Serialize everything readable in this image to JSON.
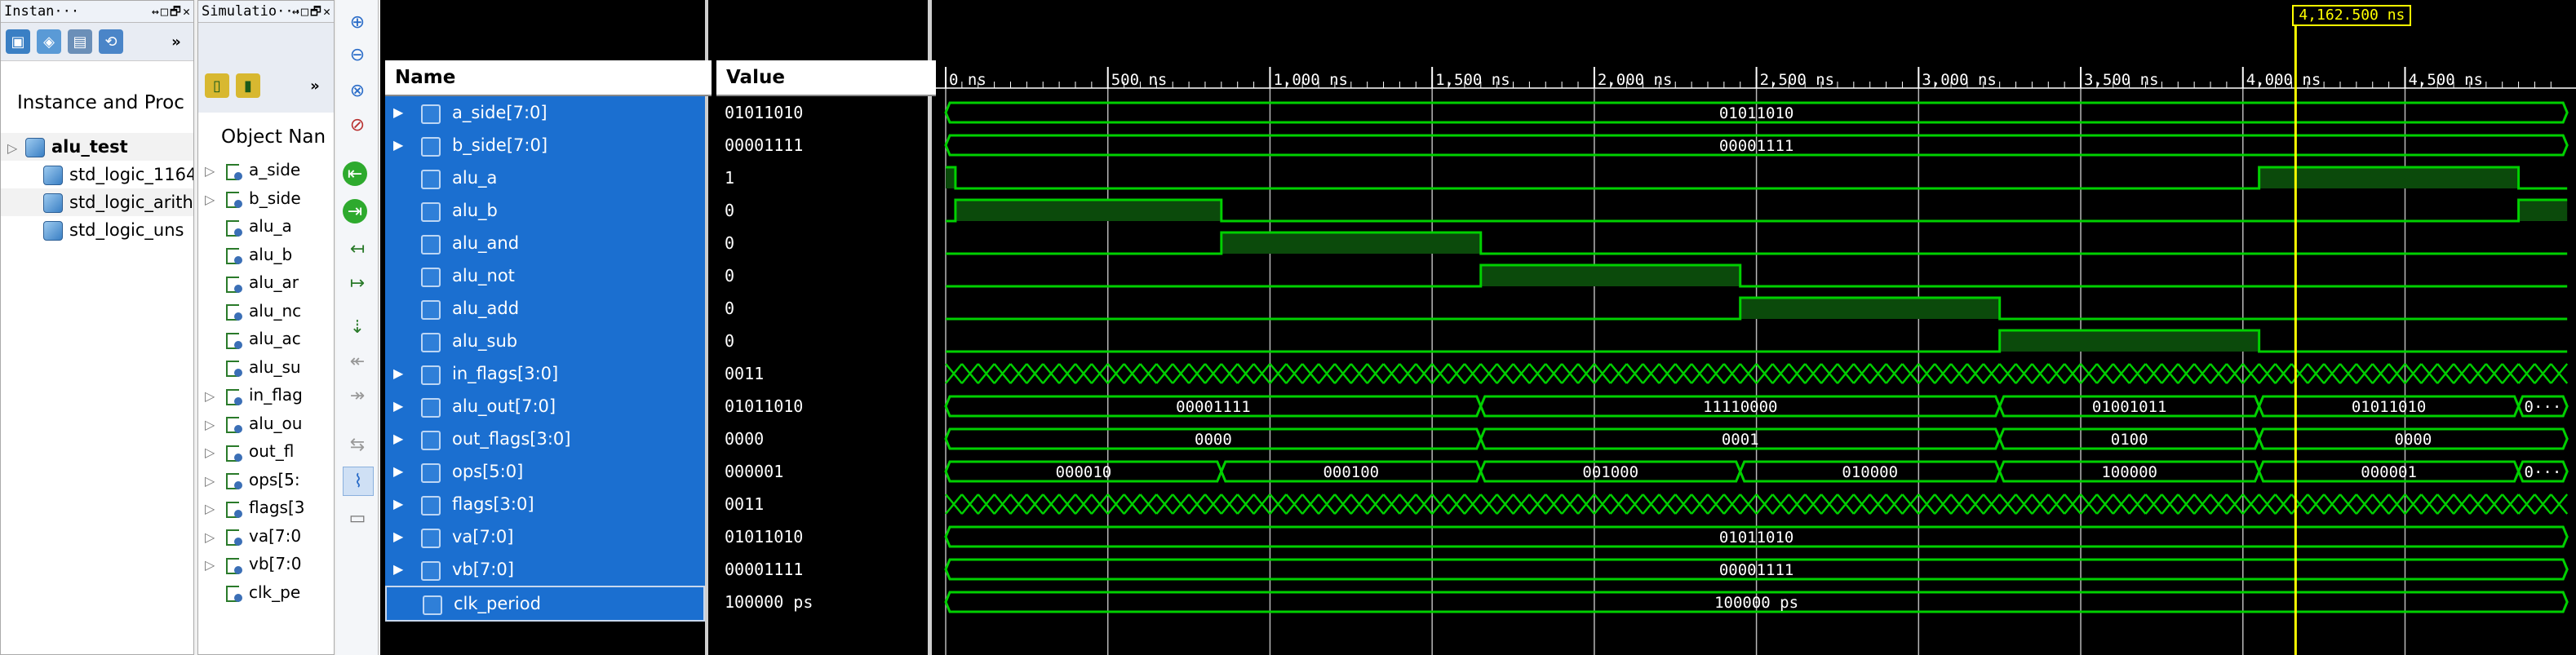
{
  "instance_panel": {
    "title": "Instan···",
    "title_controls": "↔□🗗✕",
    "column_header": "Instance and Proc",
    "items": [
      {
        "label": "alu_test",
        "bold": true
      },
      {
        "label": "std_logic_1164"
      },
      {
        "label": "std_logic_arith"
      },
      {
        "label": "std_logic_uns"
      }
    ]
  },
  "objects_panel": {
    "title": "Simulatio···",
    "title_controls": "↔□🗗✕",
    "column_header": "Object Nan",
    "items": [
      "a_side",
      "b_side",
      "alu_a",
      "alu_b",
      "alu_ar",
      "alu_nc",
      "alu_ac",
      "alu_su",
      "in_flag",
      "alu_ou",
      "out_fl",
      "ops[5:",
      "flags[3",
      "va[7:0",
      "vb[7:0",
      "clk_pe"
    ]
  },
  "wave_header": {
    "name_label": "Name",
    "value_label": "Value",
    "cursor_label": "4,162.500 ns"
  },
  "signals": [
    {
      "name": "a_side[7:0]",
      "value": "01011010",
      "expand": true
    },
    {
      "name": "b_side[7:0]",
      "value": "00001111",
      "expand": true
    },
    {
      "name": "alu_a",
      "value": "1",
      "expand": false
    },
    {
      "name": "alu_b",
      "value": "0",
      "expand": false
    },
    {
      "name": "alu_and",
      "value": "0",
      "expand": false
    },
    {
      "name": "alu_not",
      "value": "0",
      "expand": false
    },
    {
      "name": "alu_add",
      "value": "0",
      "expand": false
    },
    {
      "name": "alu_sub",
      "value": "0",
      "expand": false
    },
    {
      "name": "in_flags[3:0]",
      "value": "0011",
      "expand": true
    },
    {
      "name": "alu_out[7:0]",
      "value": "01011010",
      "expand": true
    },
    {
      "name": "out_flags[3:0]",
      "value": "0000",
      "expand": true
    },
    {
      "name": "ops[5:0]",
      "value": "000001",
      "expand": true
    },
    {
      "name": "flags[3:0]",
      "value": "0011",
      "expand": true
    },
    {
      "name": "va[7:0]",
      "value": "01011010",
      "expand": true
    },
    {
      "name": "vb[7:0]",
      "value": "00001111",
      "expand": true
    },
    {
      "name": "clk_period",
      "value": "100000 ps",
      "expand": false
    }
  ],
  "ruler": {
    "ticks": [
      "0 ns",
      "500 ns",
      "1,000 ns",
      "1,500 ns",
      "2,000 ns",
      "2,500 ns",
      "3,000 ns",
      "3,500 ns",
      "4,000 ns",
      "4,500 ns"
    ]
  },
  "waves": {
    "time_end_ns": 5000,
    "cursor_ns": 4162.5,
    "bits": [
      {
        "row": 2,
        "high": [
          [
            0,
            30
          ],
          [
            4050,
            4850
          ]
        ]
      },
      {
        "row": 3,
        "high": [
          [
            30,
            850
          ],
          [
            4850,
            5000
          ]
        ]
      },
      {
        "row": 4,
        "high": [
          [
            850,
            1650
          ]
        ]
      },
      {
        "row": 5,
        "high": [
          [
            1650,
            2450
          ]
        ]
      },
      {
        "row": 6,
        "high": [
          [
            2450,
            3250
          ]
        ]
      },
      {
        "row": 7,
        "high": [
          [
            3250,
            4050
          ]
        ]
      }
    ],
    "buses": [
      {
        "row": 0,
        "segments": [
          {
            "start": 0,
            "end": 5000,
            "label": "01011010"
          }
        ]
      },
      {
        "row": 1,
        "segments": [
          {
            "start": 0,
            "end": 5000,
            "label": "00001111"
          }
        ]
      },
      {
        "row": 9,
        "segments": [
          {
            "start": 0,
            "end": 1650,
            "label": "00001111"
          },
          {
            "start": 1650,
            "end": 3250,
            "label": "11110000"
          },
          {
            "start": 3250,
            "end": 4050,
            "label": "01001011"
          },
          {
            "start": 4050,
            "end": 4850,
            "label": "01011010"
          },
          {
            "start": 4850,
            "end": 5000,
            "label": "0···"
          }
        ]
      },
      {
        "row": 10,
        "segments": [
          {
            "start": 0,
            "end": 1650,
            "label": "0000"
          },
          {
            "start": 1650,
            "end": 3250,
            "label": "0001"
          },
          {
            "start": 3250,
            "end": 4050,
            "label": "0100"
          },
          {
            "start": 4050,
            "end": 5000,
            "label": "0000"
          }
        ]
      },
      {
        "row": 11,
        "segments": [
          {
            "start": 0,
            "end": 850,
            "label": "000010"
          },
          {
            "start": 850,
            "end": 1650,
            "label": "000100"
          },
          {
            "start": 1650,
            "end": 2450,
            "label": "001000"
          },
          {
            "start": 2450,
            "end": 3250,
            "label": "010000"
          },
          {
            "start": 3250,
            "end": 4050,
            "label": "100000"
          },
          {
            "start": 4050,
            "end": 4850,
            "label": "000001"
          },
          {
            "start": 4850,
            "end": 5000,
            "label": "0···"
          }
        ]
      },
      {
        "row": 13,
        "segments": [
          {
            "start": 0,
            "end": 5000,
            "label": "01011010"
          }
        ]
      },
      {
        "row": 14,
        "segments": [
          {
            "start": 0,
            "end": 5000,
            "label": "00001111"
          }
        ]
      },
      {
        "row": 15,
        "segments": [
          {
            "start": 0,
            "end": 5000,
            "label": "100000 ps"
          }
        ]
      }
    ],
    "dense_rows": [
      8,
      12
    ],
    "dense_period_ns": 50
  },
  "colors": {
    "wave": "#00d000",
    "high_fill": "#0b4a0b",
    "cursor": "#ffff00",
    "selection": "#1b6fd0"
  }
}
